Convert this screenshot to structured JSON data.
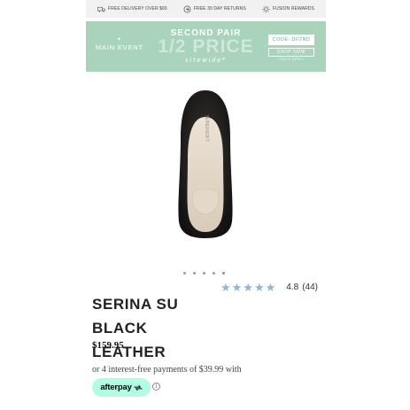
{
  "infobar": {
    "items": [
      {
        "label": "FREE DELIVERY OVER $65",
        "icon": "truck-icon"
      },
      {
        "label": "FREE 30 DAY RETURNS",
        "icon": "returns-icon"
      },
      {
        "label": "FUSION REWARDS",
        "icon": "rewards-sun-icon"
      }
    ]
  },
  "banner": {
    "main_event": "MAIN EVENT",
    "headline": "SECOND PAIR",
    "subheadline": "1/2 PRICE",
    "tagline": "sitewide*",
    "code": "CODE: DF2ND",
    "shop_label": "SHOP NOW",
    "tcs": "*T&C'S APPLY",
    "color": "#a9d3bb"
  },
  "product": {
    "image_icon": "black-leather-pump-top-view",
    "insole_brand": "SUPERSOFT",
    "title": "SERINA SU BLACK LEATHER",
    "price": "$159.95"
  },
  "carousel": {
    "dot_count": 5,
    "active_index": 4,
    "active_color": "#d9745a"
  },
  "rating": {
    "value": "4.8",
    "count": "(44)",
    "stars": 5,
    "star_color": "#8fb4d6"
  },
  "payment": {
    "installments": "or 4 interest-free payments of $39.99 with",
    "afterpay_label": "afterpay",
    "afterpay_color": "#b2fce4",
    "info_icon_glyph": "i"
  }
}
